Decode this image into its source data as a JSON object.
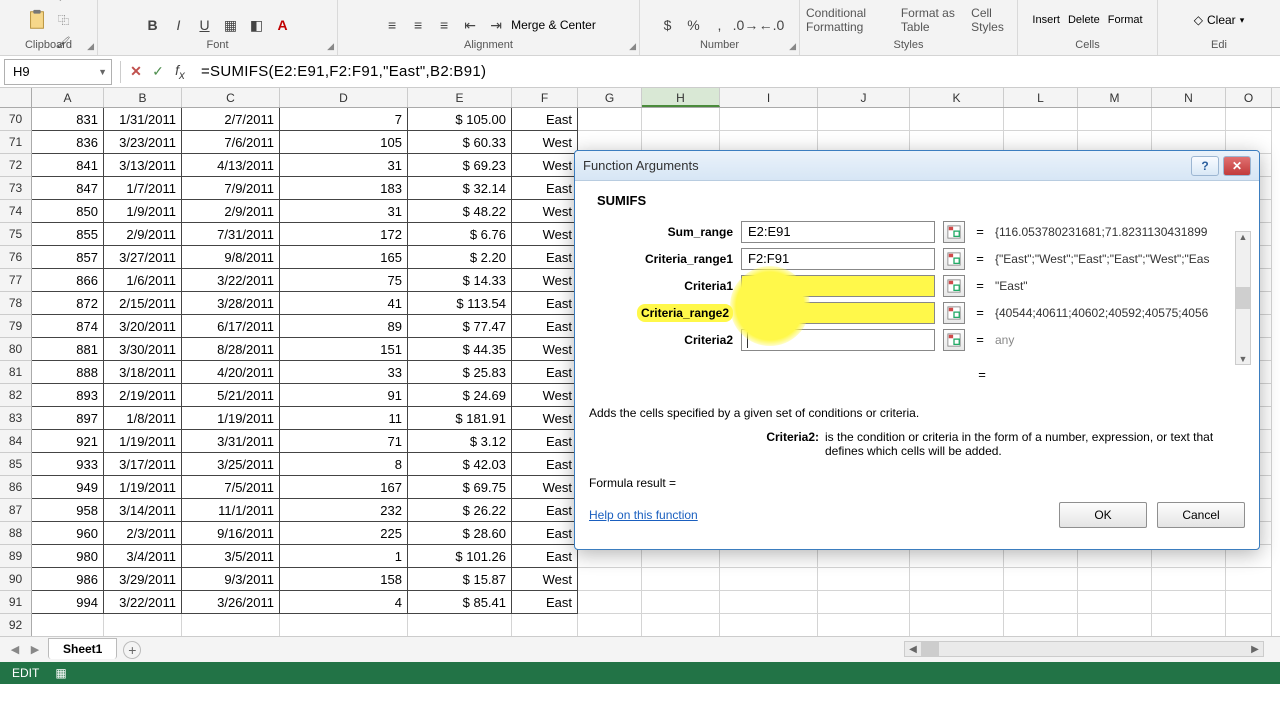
{
  "ribbon": {
    "groups": [
      "Clipboard",
      "Font",
      "Alignment",
      "Number",
      "Styles",
      "Cells",
      "Edi"
    ],
    "merge_label": "Merge & Center",
    "cond_fmt": "Conditional Formatting",
    "fmt_table": "Format as Table",
    "cell_styles": "Cell Styles",
    "insert": "Insert",
    "delete": "Delete",
    "format": "Format",
    "clear": "Clear"
  },
  "namebox": {
    "ref": "H9"
  },
  "formula_bar": {
    "value": "=SUMIFS(E2:E91,F2:F91,\"East\",B2:B91)"
  },
  "columns": [
    "A",
    "B",
    "C",
    "D",
    "E",
    "F",
    "G",
    "H",
    "I",
    "J",
    "K",
    "L",
    "M",
    "N",
    "O"
  ],
  "selected_col": "H",
  "row_start": 70,
  "rows": [
    {
      "a": "831",
      "b": "1/31/2011",
      "c": "2/7/2011",
      "d": "7",
      "e": "$ 105.00",
      "f": "East"
    },
    {
      "a": "836",
      "b": "3/23/2011",
      "c": "7/6/2011",
      "d": "105",
      "e": "$   60.33",
      "f": "West"
    },
    {
      "a": "841",
      "b": "3/13/2011",
      "c": "4/13/2011",
      "d": "31",
      "e": "$   69.23",
      "f": "West"
    },
    {
      "a": "847",
      "b": "1/7/2011",
      "c": "7/9/2011",
      "d": "183",
      "e": "$   32.14",
      "f": "East"
    },
    {
      "a": "850",
      "b": "1/9/2011",
      "c": "2/9/2011",
      "d": "31",
      "e": "$   48.22",
      "f": "West"
    },
    {
      "a": "855",
      "b": "2/9/2011",
      "c": "7/31/2011",
      "d": "172",
      "e": "$     6.76",
      "f": "West"
    },
    {
      "a": "857",
      "b": "3/27/2011",
      "c": "9/8/2011",
      "d": "165",
      "e": "$     2.20",
      "f": "East"
    },
    {
      "a": "866",
      "b": "1/6/2011",
      "c": "3/22/2011",
      "d": "75",
      "e": "$   14.33",
      "f": "West"
    },
    {
      "a": "872",
      "b": "2/15/2011",
      "c": "3/28/2011",
      "d": "41",
      "e": "$ 113.54",
      "f": "East"
    },
    {
      "a": "874",
      "b": "3/20/2011",
      "c": "6/17/2011",
      "d": "89",
      "e": "$   77.47",
      "f": "East"
    },
    {
      "a": "881",
      "b": "3/30/2011",
      "c": "8/28/2011",
      "d": "151",
      "e": "$   44.35",
      "f": "West"
    },
    {
      "a": "888",
      "b": "3/18/2011",
      "c": "4/20/2011",
      "d": "33",
      "e": "$   25.83",
      "f": "East"
    },
    {
      "a": "893",
      "b": "2/19/2011",
      "c": "5/21/2011",
      "d": "91",
      "e": "$   24.69",
      "f": "West"
    },
    {
      "a": "897",
      "b": "1/8/2011",
      "c": "1/19/2011",
      "d": "11",
      "e": "$ 181.91",
      "f": "West"
    },
    {
      "a": "921",
      "b": "1/19/2011",
      "c": "3/31/2011",
      "d": "71",
      "e": "$     3.12",
      "f": "East"
    },
    {
      "a": "933",
      "b": "3/17/2011",
      "c": "3/25/2011",
      "d": "8",
      "e": "$   42.03",
      "f": "East"
    },
    {
      "a": "949",
      "b": "1/19/2011",
      "c": "7/5/2011",
      "d": "167",
      "e": "$   69.75",
      "f": "West"
    },
    {
      "a": "958",
      "b": "3/14/2011",
      "c": "11/1/2011",
      "d": "232",
      "e": "$   26.22",
      "f": "East"
    },
    {
      "a": "960",
      "b": "2/3/2011",
      "c": "9/16/2011",
      "d": "225",
      "e": "$   28.60",
      "f": "East"
    },
    {
      "a": "980",
      "b": "3/4/2011",
      "c": "3/5/2011",
      "d": "1",
      "e": "$ 101.26",
      "f": "East"
    },
    {
      "a": "986",
      "b": "3/29/2011",
      "c": "9/3/2011",
      "d": "158",
      "e": "$   15.87",
      "f": "West"
    },
    {
      "a": "994",
      "b": "3/22/2011",
      "c": "3/26/2011",
      "d": "4",
      "e": "$   85.41",
      "f": "East"
    }
  ],
  "sheet": {
    "name": "Sheet1"
  },
  "status": {
    "mode": "EDIT"
  },
  "dialog": {
    "title": "Function Arguments",
    "function": "SUMIFS",
    "args": [
      {
        "label": "Sum_range",
        "value": "E2:E91",
        "preview": "{116.053780231681;71.8231130431899"
      },
      {
        "label": "Criteria_range1",
        "value": "F2:F91",
        "preview": "{\"East\";\"West\";\"East\";\"East\";\"West\";\"Eas"
      },
      {
        "label": "Criteria1",
        "value": "\"East\"",
        "preview": "\"East\""
      },
      {
        "label": "Criteria_range2",
        "value": "B2:B91",
        "preview": "{40544;40611;40602;40592;40575;4056"
      },
      {
        "label": "Criteria2",
        "value": "",
        "preview": "any"
      }
    ],
    "desc": "Adds the cells specified by a given set of conditions or criteria.",
    "arg_help_key": "Criteria2:",
    "arg_help_val": "is the condition or criteria in the form of a number, expression, or text that defines which cells will be added.",
    "result_label": "Formula result =",
    "help": "Help on this function",
    "ok": "OK",
    "cancel": "Cancel"
  }
}
